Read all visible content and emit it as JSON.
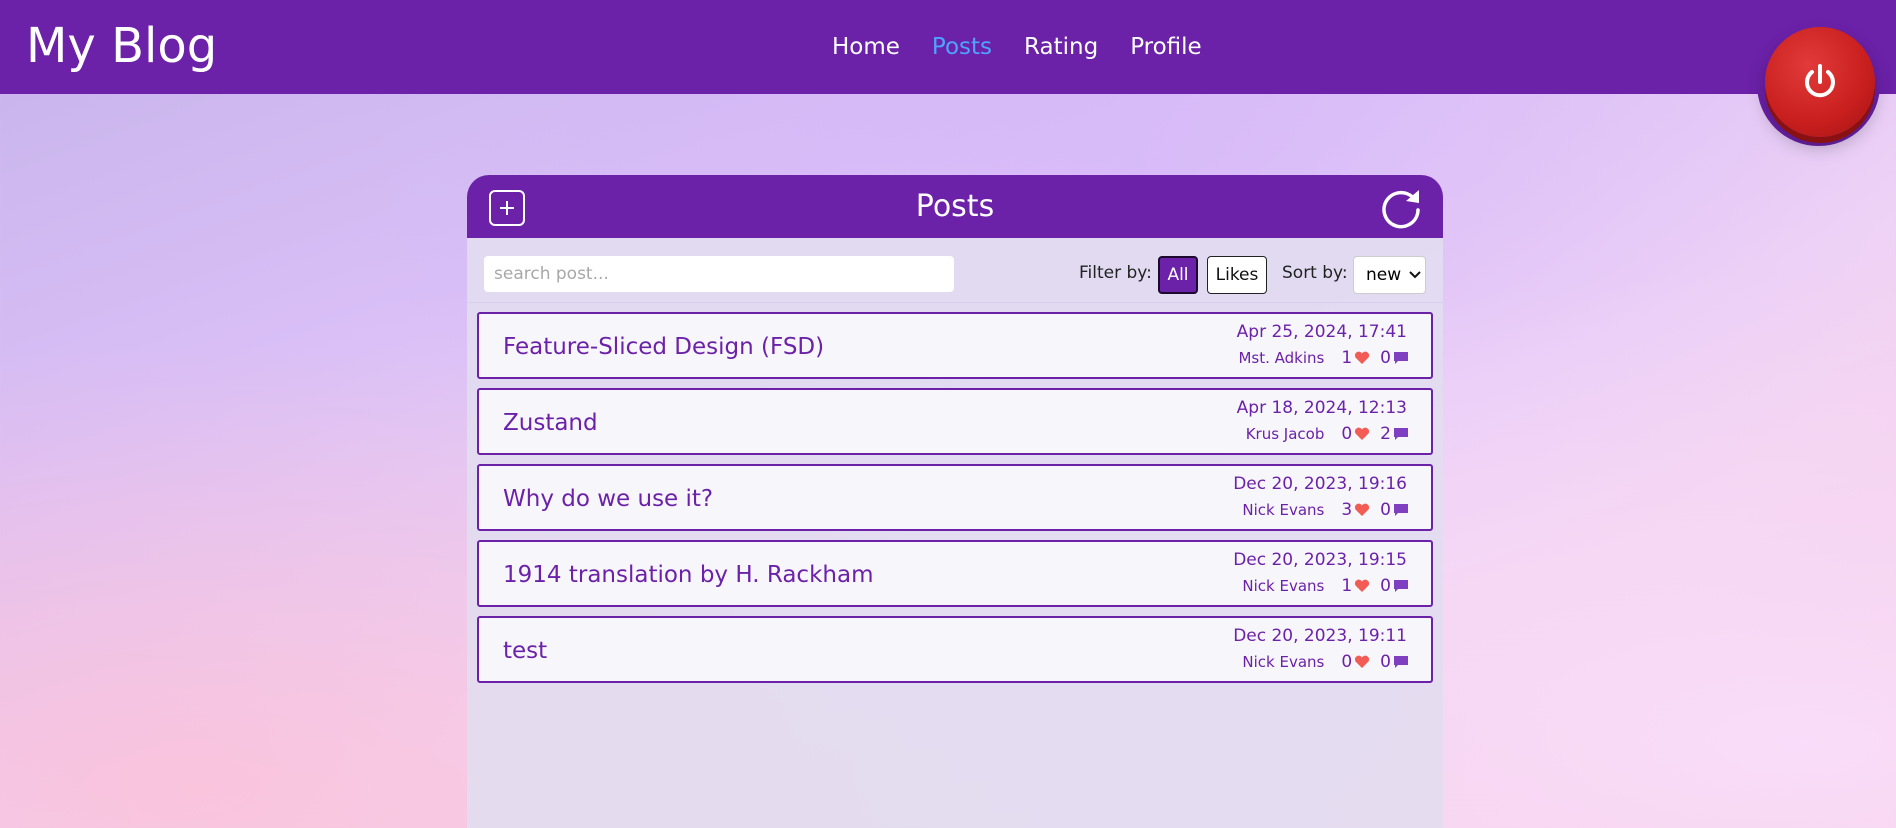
{
  "header": {
    "brand": "My Blog",
    "nav": [
      {
        "label": "Home",
        "active": false
      },
      {
        "label": "Posts",
        "active": true
      },
      {
        "label": "Rating",
        "active": false
      },
      {
        "label": "Profile",
        "active": false
      }
    ],
    "power_icon": "power-icon"
  },
  "panel": {
    "title": "Posts",
    "add_icon": "plus-icon",
    "refresh_icon": "refresh-icon"
  },
  "toolbar": {
    "search_placeholder": "search post...",
    "filter_label": "Filter by:",
    "filter_all": "All",
    "filter_likes": "Likes",
    "sort_label": "Sort by:",
    "sort_value": "new"
  },
  "posts": [
    {
      "title": "Feature-Sliced Design (FSD)",
      "date": "Apr 25, 2024, 17:41",
      "author": "Mst. Adkins",
      "likes": "1",
      "comments": "0"
    },
    {
      "title": "Zustand",
      "date": "Apr 18, 2024, 12:13",
      "author": "Krus Jacob",
      "likes": "0",
      "comments": "2"
    },
    {
      "title": "Why do we use it?",
      "date": "Dec 20, 2023, 19:16",
      "author": "Nick Evans",
      "likes": "3",
      "comments": "0"
    },
    {
      "title": "1914 translation by H. Rackham",
      "date": "Dec 20, 2023, 19:15",
      "author": "Nick Evans",
      "likes": "1",
      "comments": "0"
    },
    {
      "title": "test",
      "date": "Dec 20, 2023, 19:11",
      "author": "Nick Evans",
      "likes": "0",
      "comments": "0"
    }
  ],
  "colors": {
    "primary": "#6b21a8",
    "active_nav": "#4fa3ff",
    "heart": "#f25c54",
    "comment": "#7e3fc0",
    "power": "#c81e1e"
  }
}
